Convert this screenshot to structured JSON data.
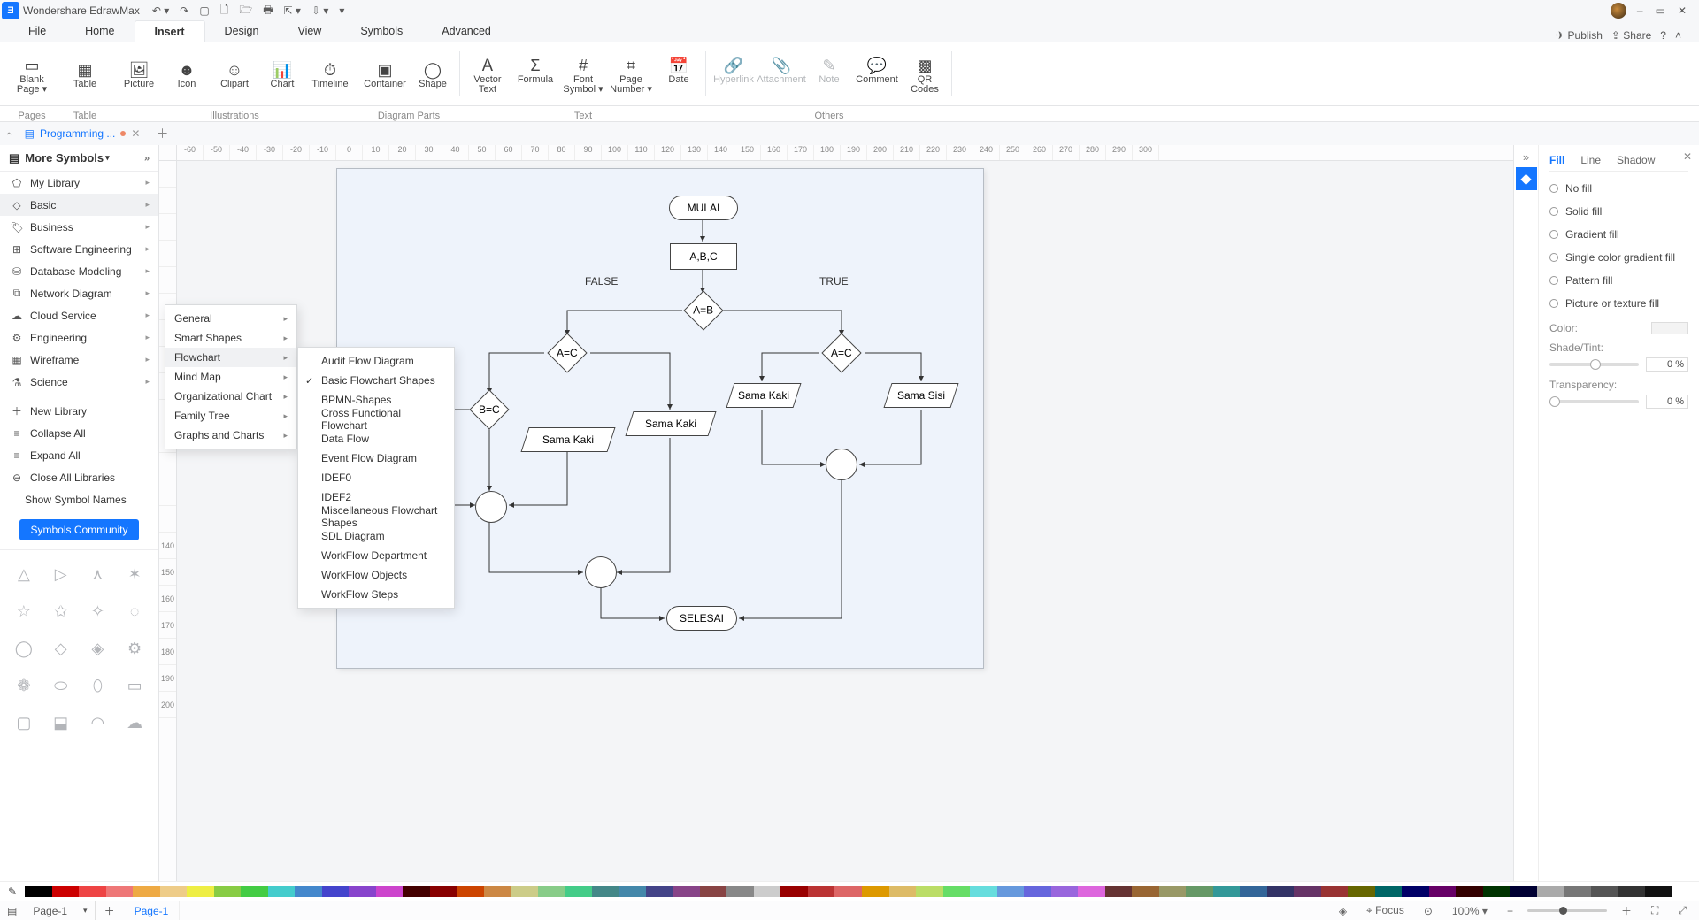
{
  "app": {
    "title": "Wondershare EdrawMax"
  },
  "qat": [
    "↶ ▾",
    "↷",
    "▢",
    "🗋",
    "🗁",
    "🖶",
    "⇱ ▾",
    "⇩ ▾",
    "▾"
  ],
  "winbtns": [
    "–",
    "▭",
    "✕"
  ],
  "menu": {
    "items": [
      "File",
      "Home",
      "Insert",
      "Design",
      "View",
      "Symbols",
      "Advanced"
    ],
    "active": "Insert",
    "right": {
      "publish": "Publish",
      "share": "Share",
      "help": "?",
      "collapse": "˄"
    }
  },
  "ribbon": {
    "pages": [
      {
        "label": "Blank\nPage ▾"
      }
    ],
    "tables": [
      {
        "label": "Table"
      }
    ],
    "illustrations": [
      {
        "label": "Picture"
      },
      {
        "label": "Icon"
      },
      {
        "label": "Clipart"
      },
      {
        "label": "Chart"
      },
      {
        "label": "Timeline"
      }
    ],
    "diagramParts": [
      {
        "label": "Container"
      },
      {
        "label": "Shape"
      }
    ],
    "text": [
      {
        "label": "Vector\nText"
      },
      {
        "label": "Formula"
      },
      {
        "label": "Font\nSymbol ▾"
      },
      {
        "label": "Page\nNumber ▾"
      },
      {
        "label": "Date"
      }
    ],
    "others": [
      {
        "label": "Hyperlink",
        "disabled": true
      },
      {
        "label": "Attachment",
        "disabled": true
      },
      {
        "label": "Note",
        "disabled": true
      },
      {
        "label": "Comment"
      },
      {
        "label": "QR\nCodes"
      }
    ],
    "groupLabels": {
      "pages": "Pages",
      "table": "Table",
      "illustrations": "Illustrations",
      "diagram": "Diagram Parts",
      "text": "Text",
      "others": "Others"
    }
  },
  "doctab": {
    "name": "Programming ...",
    "close": "✕"
  },
  "hruler_ticks": [
    "-60",
    "-50",
    "-40",
    "-30",
    "-20",
    "-10",
    "0",
    "10",
    "20",
    "30",
    "40",
    "50",
    "60",
    "70",
    "80",
    "90",
    "100",
    "110",
    "120",
    "130",
    "140",
    "150",
    "160",
    "170",
    "180",
    "190",
    "200",
    "210",
    "220",
    "230",
    "240",
    "250",
    "260",
    "270",
    "280",
    "290",
    "300"
  ],
  "vruler_ticks": [
    "",
    "",
    "",
    "",
    "",
    "",
    "",
    "",
    "",
    "",
    "",
    "",
    "",
    "",
    "140",
    "150",
    "160",
    "170",
    "180",
    "190",
    "200"
  ],
  "leftpanel": {
    "header": "More Symbols",
    "cats": [
      {
        "ic": "⬠",
        "label": "My Library"
      },
      {
        "ic": "◇",
        "label": "Basic",
        "hover": true
      },
      {
        "ic": "🏷",
        "label": "Business"
      },
      {
        "ic": "⊞",
        "label": "Software Engineering"
      },
      {
        "ic": "⛁",
        "label": "Database Modeling"
      },
      {
        "ic": "⧉",
        "label": "Network Diagram"
      },
      {
        "ic": "☁",
        "label": "Cloud Service"
      },
      {
        "ic": "⚙",
        "label": "Engineering"
      },
      {
        "ic": "▦",
        "label": "Wireframe"
      },
      {
        "ic": "⚗",
        "label": "Science"
      }
    ],
    "libops": [
      {
        "ic": "＋",
        "label": "New Library"
      },
      {
        "ic": "≡",
        "label": "Collapse All"
      },
      {
        "ic": "≡",
        "label": "Expand All"
      },
      {
        "ic": "⊖",
        "label": "Close All Libraries"
      }
    ],
    "shownames": "Show Symbol Names",
    "community": "Symbols Community"
  },
  "popup1": [
    {
      "label": "General"
    },
    {
      "label": "Smart Shapes"
    },
    {
      "label": "Flowchart",
      "hover": true
    },
    {
      "label": "Mind Map"
    },
    {
      "label": "Organizational Chart"
    },
    {
      "label": "Family Tree"
    },
    {
      "label": "Graphs and Charts"
    }
  ],
  "popup2": [
    {
      "label": "Audit Flow Diagram"
    },
    {
      "label": "Basic Flowchart Shapes",
      "checked": true
    },
    {
      "label": "BPMN-Shapes"
    },
    {
      "label": "Cross Functional Flowchart"
    },
    {
      "label": "Data Flow"
    },
    {
      "label": "Event Flow Diagram"
    },
    {
      "label": "IDEF0"
    },
    {
      "label": "IDEF2"
    },
    {
      "label": "Miscellaneous Flowchart Shapes"
    },
    {
      "label": "SDL Diagram"
    },
    {
      "label": "WorkFlow Department"
    },
    {
      "label": "WorkFlow Objects"
    },
    {
      "label": "WorkFlow Steps"
    }
  ],
  "flow": {
    "mulai": "MULAI",
    "abc": "A,B,C",
    "false": "FALSE",
    "true": "TRUE",
    "aeqb": "A=B",
    "aeqc1": "A=C",
    "aeqc2": "A=C",
    "beqc": "B=C",
    "samakaki1": "Sama Kaki",
    "samakaki2": "Sama Kaki",
    "samakaki3": "Sama Kaki",
    "samasisi": "Sama Sisi",
    "selesai": "SELESAI"
  },
  "rightpanel": {
    "tabs": {
      "fill": "Fill",
      "line": "Line",
      "shadow": "Shadow"
    },
    "opts": [
      "No fill",
      "Solid fill",
      "Gradient fill",
      "Single color gradient fill",
      "Pattern fill",
      "Picture or texture fill"
    ],
    "color": "Color:",
    "shade": "Shade/Tint:",
    "trans": "Transparency:",
    "zero": "0 %"
  },
  "status": {
    "page": "Page-1",
    "pagetab": "Page-1",
    "focus": "Focus",
    "zoom": "100% ▾"
  }
}
